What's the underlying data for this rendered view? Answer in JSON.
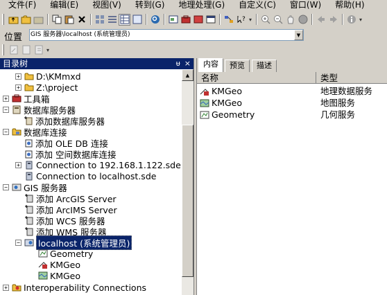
{
  "menu": [
    "文件(F)",
    "编辑(E)",
    "视图(V)",
    "转到(G)",
    "地理处理(G)",
    "自定义(C)",
    "窗口(W)",
    "帮助(H)"
  ],
  "location": {
    "label": "位置",
    "value": "GIS 服务器\\localhost (系统管理员)"
  },
  "tree_panel": {
    "title": "目录树",
    "pin": "ᵾ",
    "close": "×",
    "items": [
      {
        "label": "D:\\KMmxd"
      },
      {
        "label": "Z:\\project"
      },
      {
        "label": "工具箱"
      },
      {
        "label": "数据库服务器"
      },
      {
        "label": "添加数据库服务器"
      },
      {
        "label": "数据库连接"
      },
      {
        "label": "添加 OLE DB 连接"
      },
      {
        "label": "添加 空间数据库连接"
      },
      {
        "label": "Connection to 192.168.1.122.sde"
      },
      {
        "label": "Connection to localhost.sde"
      },
      {
        "label": "GIS 服务器"
      },
      {
        "label": "添加 ArcGIS Server"
      },
      {
        "label": "添加 ArcIMS Server"
      },
      {
        "label": "添加 WCS 服务器"
      },
      {
        "label": "添加 WMS 服务器"
      },
      {
        "label": "localhost (系统管理员)"
      },
      {
        "label": "Geometry"
      },
      {
        "label": "KMGeo"
      },
      {
        "label": "KMGeo"
      },
      {
        "label": "Interoperability Connections"
      }
    ]
  },
  "tabs": [
    "内容",
    "预览",
    "描述"
  ],
  "table": {
    "columns": [
      "名称",
      "类型"
    ],
    "rows": [
      {
        "name": "KMGeo",
        "type": "地理数据服务"
      },
      {
        "name": "KMGeo",
        "type": "地图服务"
      },
      {
        "name": "Geometry",
        "type": "几何服务"
      }
    ]
  },
  "colors": {
    "selection": "#0a246a",
    "chrome": "#d4d0c8",
    "folder": "#f0c040"
  }
}
